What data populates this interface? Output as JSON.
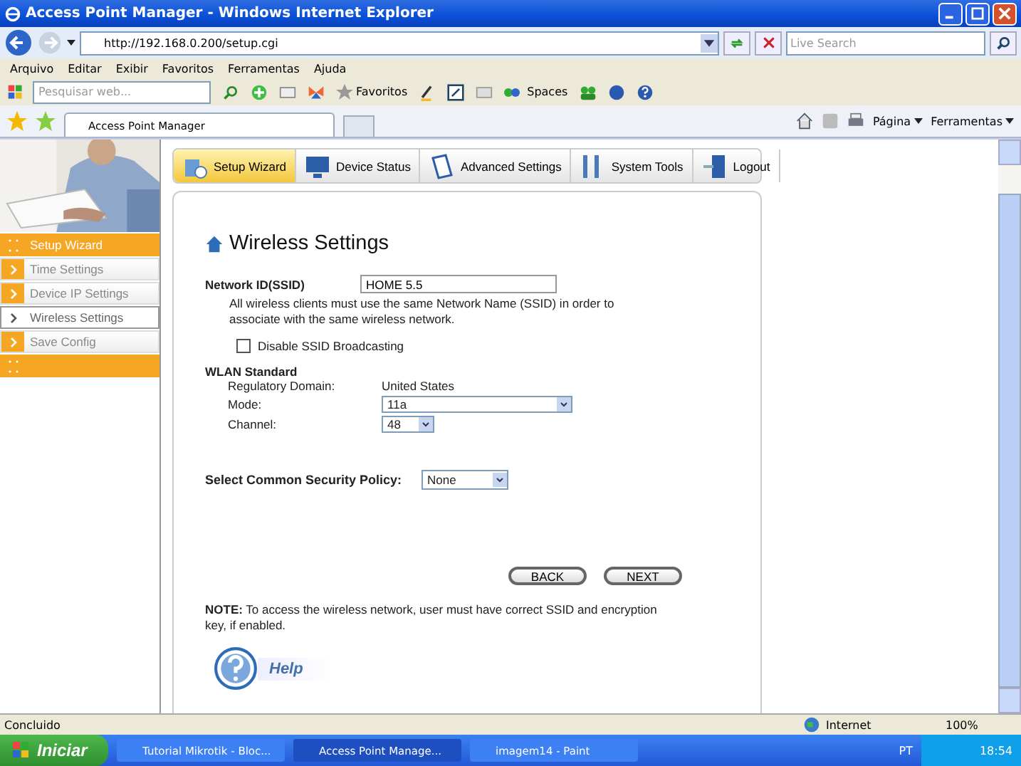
{
  "window": {
    "title": "Access Point Manager - Windows Internet Explorer"
  },
  "address_bar": {
    "url": "http://192.168.0.200/setup.cgi",
    "search_placeholder": "Live Search"
  },
  "menu": [
    "Arquivo",
    "Editar",
    "Exibir",
    "Favoritos",
    "Ferramentas",
    "Ajuda"
  ],
  "toolbar": {
    "search_placeholder": "Pesquisar web...",
    "favorites": "Favoritos",
    "spaces": "Spaces"
  },
  "browser_tabs": [
    {
      "label": "Access Point Manager",
      "selected": true
    }
  ],
  "command_bar": [
    "Página",
    "Ferramentas"
  ],
  "sidebar": {
    "items": [
      {
        "label": "Setup Wizard",
        "kind": "section",
        "selected": false
      },
      {
        "label": "Time Settings",
        "kind": "link",
        "selected": false
      },
      {
        "label": "Device IP Settings",
        "kind": "link",
        "selected": false
      },
      {
        "label": "Wireless Settings",
        "kind": "link",
        "selected": true
      },
      {
        "label": "Save Config",
        "kind": "link",
        "selected": false
      },
      {
        "kind": "section",
        "selected": false
      }
    ]
  },
  "nav_tabs": [
    {
      "label": "Setup Wizard",
      "selected": true
    },
    {
      "label": "Device Status",
      "selected": false
    },
    {
      "label": "Advanced Settings",
      "selected": false
    },
    {
      "label": "System Tools",
      "selected": false
    },
    {
      "label": "Logout",
      "selected": false
    }
  ],
  "form": {
    "heading": "Wireless Settings",
    "ssid_label": "Network ID(SSID)",
    "ssid_value": "HOME 5.5",
    "ssid_hint": "All wireless clients must use the same Network Name (SSID) in order to associate with the same wireless network.",
    "broadcast": {
      "label": "Disable SSID Broadcasting",
      "checked": false
    },
    "wlan_heading": "WLAN Standard",
    "domain_label": "Regulatory Domain:",
    "domain_value": "United States",
    "mode_label": "Mode:",
    "mode_value": "11a",
    "channel_label": "Channel:",
    "channel_value": "48",
    "security_label": "Select Common Security Policy:",
    "security_value": "None",
    "buttons": [
      "BACK",
      "NEXT"
    ],
    "note": "**NOTE:** To access the wireless network, user must have correct SSID and encryption key, if enabled.",
    "help": "Help"
  },
  "status_bar": {
    "text": "Concluido",
    "zone": "Internet",
    "zoom": "100%"
  },
  "taskbar": {
    "start": "Iniciar",
    "tasks": [
      {
        "label": "Tutorial Mikrotik - Bloc...",
        "selected": false
      },
      {
        "label": "Access Point Manage...",
        "selected": true
      },
      {
        "label": "imagem14 - Paint",
        "selected": false
      }
    ],
    "language": "PT",
    "clock": "18:54"
  }
}
